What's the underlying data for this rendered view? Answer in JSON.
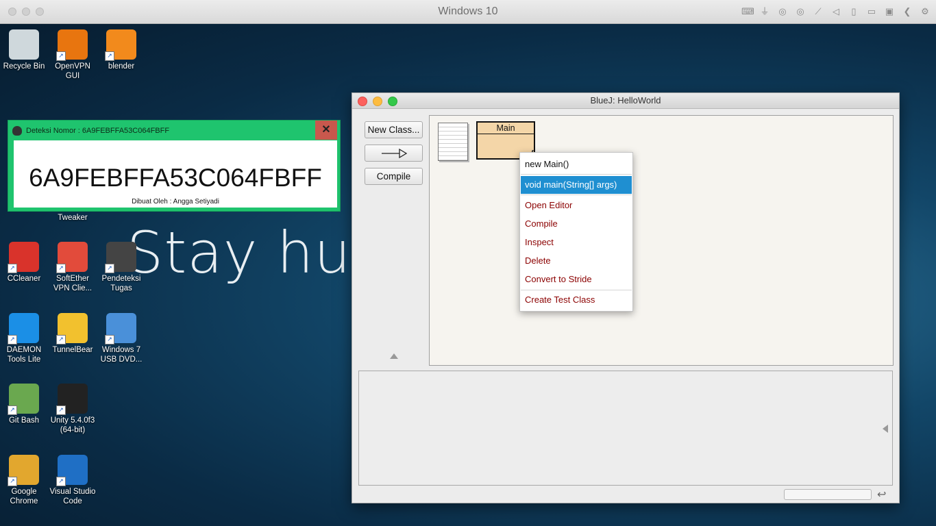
{
  "vm": {
    "title": "Windows 10",
    "tool_icons": [
      "keyboard-icon",
      "usb-icon",
      "disc-icon",
      "disc-alt-icon",
      "network-icon",
      "volume-icon",
      "phone-icon",
      "display-icon",
      "screen-icon",
      "chevron-left-icon",
      "gear-icon"
    ]
  },
  "desktop": {
    "wallpaper_text": "Stay hun",
    "icons": [
      {
        "label": "Recycle Bin",
        "name": "desktop-icon-recycle-bin",
        "color": "#cfd8dc"
      },
      {
        "label": "OpenVPN GUI",
        "name": "desktop-icon-openvpn",
        "color": "#e8750f"
      },
      {
        "label": "blender",
        "name": "desktop-icon-blender",
        "color": "#f28a1c"
      },
      {
        "label": "Tweaker",
        "name": "desktop-icon-tweaker",
        "color": "#3a7bd5"
      },
      {
        "label": "CCleaner",
        "name": "desktop-icon-ccleaner",
        "color": "#d9332b"
      },
      {
        "label": "SoftEther VPN Clie...",
        "name": "desktop-icon-softether",
        "color": "#e24b3b"
      },
      {
        "label": "Pendeteksi Tugas",
        "name": "desktop-icon-pendeteksi",
        "color": "#444444"
      },
      {
        "label": "DAEMON Tools Lite",
        "name": "desktop-icon-daemon-tools",
        "color": "#1b8fe6"
      },
      {
        "label": "TunnelBear",
        "name": "desktop-icon-tunnelbear",
        "color": "#f2c12e"
      },
      {
        "label": "Windows 7 USB DVD...",
        "name": "desktop-icon-win7-usb",
        "color": "#4a90d9"
      },
      {
        "label": "Git Bash",
        "name": "desktop-icon-git-bash",
        "color": "#6aa84f"
      },
      {
        "label": "Unity 5.4.0f3 (64-bit)",
        "name": "desktop-icon-unity",
        "color": "#222222"
      },
      {
        "label": "Google Chrome",
        "name": "desktop-icon-chrome",
        "color": "#e2a72e"
      },
      {
        "label": "Visual Studio Code",
        "name": "desktop-icon-vscode",
        "color": "#1f6fc5"
      }
    ]
  },
  "detect": {
    "title": "Deteksi Nomor : 6A9FEBFFA53C064FBFF",
    "close_label": "✕",
    "code": "6A9FEBFFA53C064FBFF",
    "credit": "Dibuat Oleh : Angga Setiyadi"
  },
  "bluej": {
    "title": "BlueJ:  HelloWorld",
    "new_class_label": "New Class...",
    "arrow_label": "—▷",
    "compile_label": "Compile",
    "class_name": "Main",
    "undo_label": "↩"
  },
  "context_menu": {
    "items": [
      {
        "label": "new Main()",
        "color": "#111111"
      },
      {
        "label": "void main(String[] args)",
        "color": "#ffffff",
        "highlight": "#1f8fd1"
      },
      {
        "label": "Open Editor",
        "color": "#8b0000"
      },
      {
        "label": "Compile",
        "color": "#8b0000"
      },
      {
        "label": "Inspect",
        "color": "#8b0000"
      },
      {
        "label": "Delete",
        "color": "#8b0000"
      },
      {
        "label": "Convert to Stride",
        "color": "#8b0000"
      },
      {
        "label": "Create Test Class",
        "color": "#8b0000"
      }
    ]
  }
}
